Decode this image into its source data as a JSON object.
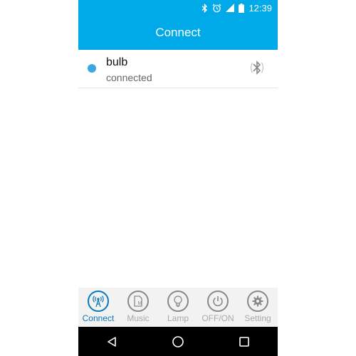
{
  "status_bar": {
    "time": "12:39",
    "icons": [
      "bluetooth-icon",
      "alarm-icon",
      "signal-icon",
      "battery-icon"
    ],
    "color": "#00a9e8"
  },
  "header": {
    "title": "Connect"
  },
  "device": {
    "name": "bulb",
    "status": "connected",
    "dot_color": "#3aa6e6",
    "icon": "bluetooth-icon"
  },
  "bottom_nav": {
    "items": [
      {
        "label": "Connect",
        "icon": "antenna-icon",
        "active": true
      },
      {
        "label": "Music",
        "icon": "music-file-icon",
        "active": false
      },
      {
        "label": "Lamp",
        "icon": "bulb-icon",
        "active": false
      },
      {
        "label": "OFF/ON",
        "icon": "power-icon",
        "active": false
      },
      {
        "label": "Setting",
        "icon": "gear-icon",
        "active": false
      }
    ]
  },
  "system_nav": {
    "buttons": [
      "back",
      "home",
      "recents"
    ]
  }
}
